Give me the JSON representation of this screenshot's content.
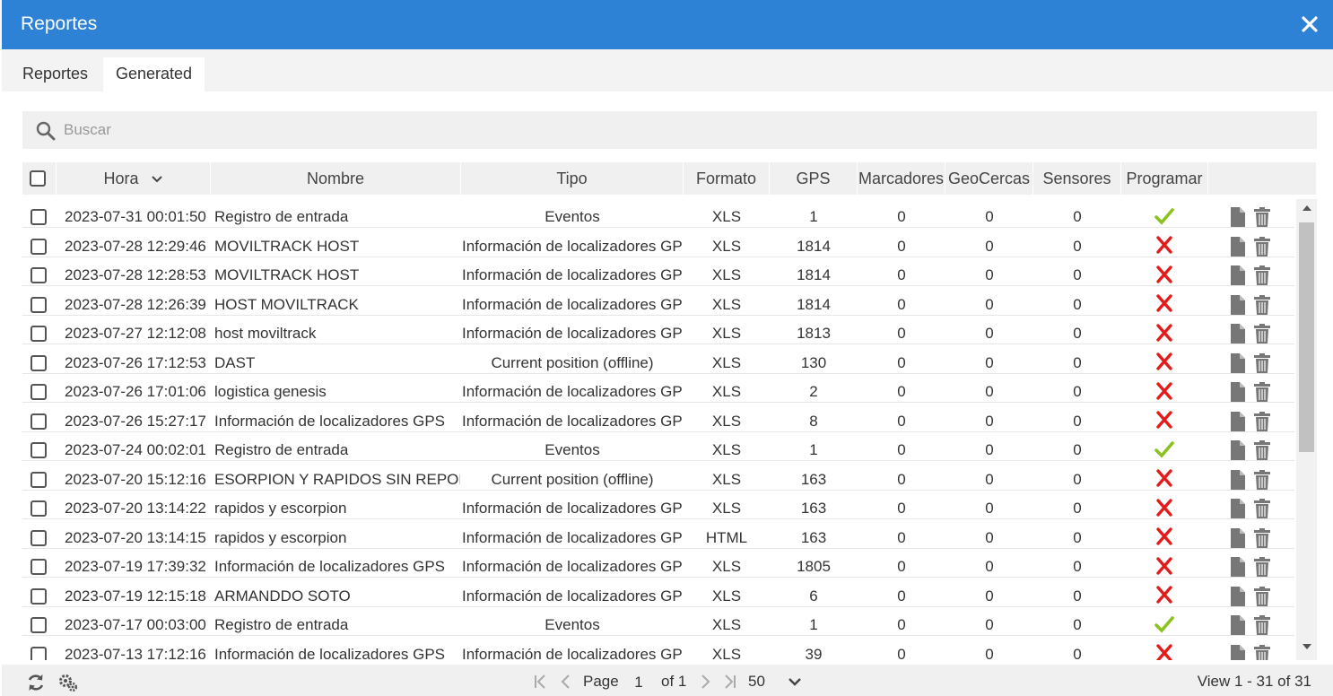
{
  "window": {
    "title": "Reportes",
    "close_icon": "close-icon"
  },
  "tabs": [
    {
      "label": "Reportes",
      "active": false
    },
    {
      "label": "Generated",
      "active": true
    }
  ],
  "search": {
    "placeholder": "Buscar",
    "value": ""
  },
  "table": {
    "columns": [
      "Hora",
      "Nombre",
      "Tipo",
      "Formato",
      "GPS",
      "Marcadores",
      "GeoCercas",
      "Sensores",
      "Programar"
    ],
    "sort_column": "Hora",
    "sort_direction": "desc",
    "rows": [
      {
        "hora": "2023-07-31 00:01:50",
        "nombre": "Registro de entrada",
        "tipo": "Eventos",
        "formato": "XLS",
        "gps": "1",
        "marcadores": "0",
        "geocercas": "0",
        "sensores": "0",
        "programar": true
      },
      {
        "hora": "2023-07-28 12:29:46",
        "nombre": "MOVILTRACK HOST",
        "tipo": "Información de localizadores GPS",
        "formato": "XLS",
        "gps": "1814",
        "marcadores": "0",
        "geocercas": "0",
        "sensores": "0",
        "programar": false
      },
      {
        "hora": "2023-07-28 12:28:53",
        "nombre": "MOVILTRACK HOST",
        "tipo": "Información de localizadores GPS",
        "formato": "XLS",
        "gps": "1814",
        "marcadores": "0",
        "geocercas": "0",
        "sensores": "0",
        "programar": false
      },
      {
        "hora": "2023-07-28 12:26:39",
        "nombre": "HOST MOVILTRACK",
        "tipo": "Información de localizadores GPS",
        "formato": "XLS",
        "gps": "1814",
        "marcadores": "0",
        "geocercas": "0",
        "sensores": "0",
        "programar": false
      },
      {
        "hora": "2023-07-27 12:12:08",
        "nombre": "host moviltrack",
        "tipo": "Información de localizadores GPS",
        "formato": "XLS",
        "gps": "1813",
        "marcadores": "0",
        "geocercas": "0",
        "sensores": "0",
        "programar": false
      },
      {
        "hora": "2023-07-26 17:12:53",
        "nombre": "DAST",
        "tipo": "Current position (offline)",
        "formato": "XLS",
        "gps": "130",
        "marcadores": "0",
        "geocercas": "0",
        "sensores": "0",
        "programar": false
      },
      {
        "hora": "2023-07-26 17:01:06",
        "nombre": "logistica genesis",
        "tipo": "Información de localizadores GPS",
        "formato": "XLS",
        "gps": "2",
        "marcadores": "0",
        "geocercas": "0",
        "sensores": "0",
        "programar": false
      },
      {
        "hora": "2023-07-26 15:27:17",
        "nombre": "Información de localizadores GPS",
        "tipo": "Información de localizadores GPS",
        "formato": "XLS",
        "gps": "8",
        "marcadores": "0",
        "geocercas": "0",
        "sensores": "0",
        "programar": false
      },
      {
        "hora": "2023-07-24 00:02:01",
        "nombre": "Registro de entrada",
        "tipo": "Eventos",
        "formato": "XLS",
        "gps": "1",
        "marcadores": "0",
        "geocercas": "0",
        "sensores": "0",
        "programar": true
      },
      {
        "hora": "2023-07-20 15:12:16",
        "nombre": "ESORPION Y RAPIDOS SIN REPORTE",
        "tipo": "Current position (offline)",
        "formato": "XLS",
        "gps": "163",
        "marcadores": "0",
        "geocercas": "0",
        "sensores": "0",
        "programar": false
      },
      {
        "hora": "2023-07-20 13:14:22",
        "nombre": "rapidos y escorpion",
        "tipo": "Información de localizadores GPS",
        "formato": "XLS",
        "gps": "163",
        "marcadores": "0",
        "geocercas": "0",
        "sensores": "0",
        "programar": false
      },
      {
        "hora": "2023-07-20 13:14:15",
        "nombre": "rapidos y escorpion",
        "tipo": "Información de localizadores GPS",
        "formato": "HTML",
        "gps": "163",
        "marcadores": "0",
        "geocercas": "0",
        "sensores": "0",
        "programar": false
      },
      {
        "hora": "2023-07-19 17:39:32",
        "nombre": "Información de localizadores GPS",
        "tipo": "Información de localizadores GPS",
        "formato": "XLS",
        "gps": "1805",
        "marcadores": "0",
        "geocercas": "0",
        "sensores": "0",
        "programar": false
      },
      {
        "hora": "2023-07-19 12:15:18",
        "nombre": "ARMANDDO SOTO",
        "tipo": "Información de localizadores GPS",
        "formato": "XLS",
        "gps": "6",
        "marcadores": "0",
        "geocercas": "0",
        "sensores": "0",
        "programar": false
      },
      {
        "hora": "2023-07-17 00:03:00",
        "nombre": "Registro de entrada",
        "tipo": "Eventos",
        "formato": "XLS",
        "gps": "1",
        "marcadores": "0",
        "geocercas": "0",
        "sensores": "0",
        "programar": true
      },
      {
        "hora": "2023-07-13 17:12:16",
        "nombre": "Información de localizadores GPS",
        "tipo": "Información de localizadores GPS",
        "formato": "XLS",
        "gps": "39",
        "marcadores": "0",
        "geocercas": "0",
        "sensores": "0",
        "programar": false
      }
    ]
  },
  "footer": {
    "page_label": "Page",
    "page_value": "1",
    "of_label": "of 1",
    "page_size": "50",
    "view_info": "View 1 - 31 of 31"
  },
  "colors": {
    "titlebar": "#2e82d6",
    "check_green": "#8cc21d",
    "cross_red": "#e31b1b"
  }
}
